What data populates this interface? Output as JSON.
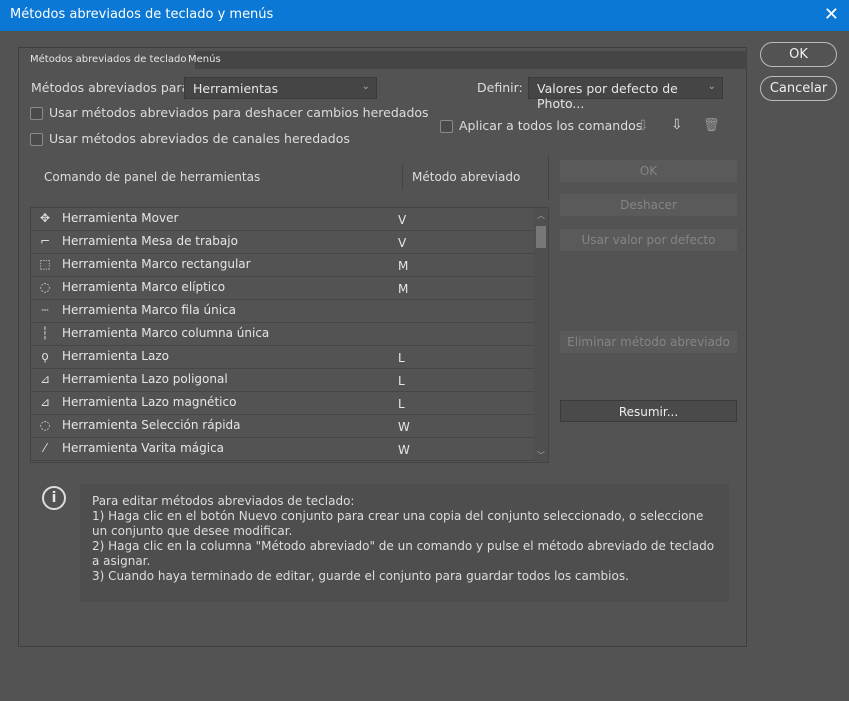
{
  "title": "Métodos abreviados de teclado y menús",
  "tabs": [
    "Métodos abreviados de teclado",
    "Menús"
  ],
  "shortcuts_for": {
    "label": "Métodos abreviados para:",
    "value": "Herramientas"
  },
  "set": {
    "label": "Definir:",
    "value": "Valores por defecto de Photo..."
  },
  "checkboxes": {
    "undo": "Usar métodos abreviados para deshacer cambios heredados",
    "channels": "Usar métodos abreviados de canales heredados",
    "apply_all": "Aplicar a todos los comandos"
  },
  "columns": {
    "command": "Comando de panel de herramientas",
    "shortcut": "Método abreviado"
  },
  "rows": [
    {
      "icon": "move-icon",
      "glyph": "✥",
      "name": "Herramienta Mover",
      "key": "V"
    },
    {
      "icon": "artboard-icon",
      "glyph": "⌐",
      "name": "Herramienta Mesa de trabajo",
      "key": "V"
    },
    {
      "icon": "rect-marquee-icon",
      "glyph": "⬚",
      "name": "Herramienta Marco rectangular",
      "key": "M"
    },
    {
      "icon": "ellipse-marquee-icon",
      "glyph": "◌",
      "name": "Herramienta Marco elíptico",
      "key": "M"
    },
    {
      "icon": "row-marquee-icon",
      "glyph": "┄",
      "name": "Herramienta Marco fila única",
      "key": ""
    },
    {
      "icon": "column-marquee-icon",
      "glyph": "┆",
      "name": "Herramienta Marco columna única",
      "key": ""
    },
    {
      "icon": "lasso-icon",
      "glyph": "ϙ",
      "name": "Herramienta Lazo",
      "key": "L"
    },
    {
      "icon": "polygonal-lasso-icon",
      "glyph": "⊿",
      "name": "Herramienta Lazo poligonal",
      "key": "L"
    },
    {
      "icon": "magnetic-lasso-icon",
      "glyph": "⊿",
      "name": "Herramienta Lazo magnético",
      "key": "L"
    },
    {
      "icon": "quick-selection-icon",
      "glyph": "◌",
      "name": "Herramienta Selección rápida",
      "key": "W"
    },
    {
      "icon": "magic-wand-icon",
      "glyph": "⁄",
      "name": "Herramienta Varita mágica",
      "key": "W"
    }
  ],
  "buttons": {
    "ok": "OK",
    "cancel": "Cancelar",
    "edit_ok": "OK",
    "undo": "Deshacer",
    "default": "Usar valor por defecto",
    "delete": "Eliminar método abreviado",
    "summarize": "Resumir..."
  },
  "info": {
    "icon": "i",
    "lines": [
      "Para editar métodos abreviados de teclado:",
      "1) Haga clic en el botón Nuevo conjunto para crear una copia del conjunto seleccionado, o seleccione un conjunto que desee modificar.",
      "2) Haga clic en la columna \"Método abreviado\" de un comando y pulse el método abreviado de teclado a asignar.",
      "3) Cuando haya terminado de editar, guarde el conjunto para guardar todos los cambios."
    ]
  }
}
